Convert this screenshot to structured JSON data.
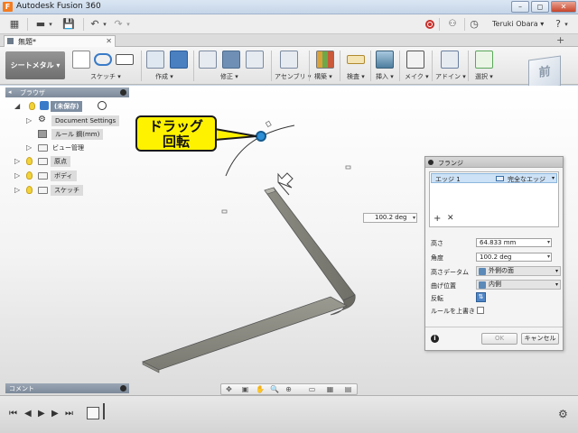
{
  "window": {
    "app_logo": "F",
    "title": "Autodesk Fusion 360",
    "minimize": "–",
    "restore": "◻",
    "close": "✕"
  },
  "quick_access": {
    "grid_icon": "▦",
    "file_icon": "▬",
    "save_icon": "💾",
    "undo_icon": "↶",
    "redo_icon": "↷",
    "dropdown": "▾",
    "help_icon": "?",
    "user_name": "Teruki Obara ▾"
  },
  "doc_tab": {
    "title": "無題*",
    "close": "✕",
    "new_tab": "+"
  },
  "ribbon": {
    "workspace": "シートメタル ▾",
    "groups": [
      {
        "label": "スケッチ ▾"
      },
      {
        "label": "作成 ▾"
      },
      {
        "label": "修正 ▾"
      },
      {
        "label": "アセンブリ ▾"
      },
      {
        "label": "構築 ▾"
      },
      {
        "label": "検査 ▾"
      },
      {
        "label": "挿入 ▾"
      },
      {
        "label": "メイク ▾"
      },
      {
        "label": "アドイン ▾"
      },
      {
        "label": "選択 ▾"
      }
    ],
    "colors": {
      "sketch": "#3a7bc8",
      "flange": "#4a7fc0",
      "modify": "#6f8fb5",
      "assembly": "#8a9bb0",
      "construct": "#6da84a",
      "inspect": "#d9a23a",
      "insert": "#4f7e9e",
      "make": "#7a7a7a",
      "addin": "#6a7fa0",
      "select": "#5aa85a"
    }
  },
  "view_cube": {
    "label": "前"
  },
  "browser": {
    "title": "ブラウザ",
    "root_label": "(未保存)",
    "items": [
      {
        "label": "Document Settings"
      },
      {
        "label": "ルール 鋼(mm)"
      },
      {
        "label": "ビュー管理"
      },
      {
        "label": "原点"
      },
      {
        "label": "ボディ"
      },
      {
        "label": "スケッチ"
      }
    ]
  },
  "comment_bar": {
    "label": "コメント"
  },
  "callout": {
    "line1": "ドラッグ",
    "line2": "回転"
  },
  "angle_input": {
    "value": "100.2 deg",
    "dropdown": "▾"
  },
  "flange_dialog": {
    "title": "フランジ",
    "edge_row": {
      "name": "エッジ 1",
      "option": "完全なエッジ",
      "dropdown": "▾"
    },
    "add_icon": "+",
    "remove_icon": "✕",
    "fields": {
      "height_label": "高さ",
      "height_value": "64.833 mm",
      "angle_label": "角度",
      "angle_value": "100.2 deg",
      "datum_label": "高さデータム",
      "datum_value": "外側の面",
      "bend_label": "曲げ位置",
      "bend_value": "内側",
      "flip_label": "反転",
      "override_label": "ルールを上書き"
    },
    "ok": "OK",
    "cancel": "キャンセル",
    "info_icon": "i"
  },
  "nav_toolbar": {
    "icons": [
      "✥",
      "▣",
      "✋",
      "🔍",
      "⊕",
      "▭",
      "▦",
      "▤"
    ]
  },
  "timeline": {
    "first": "⏮",
    "prev": "◀",
    "play": "▶",
    "next": "▶",
    "last": "⏭",
    "gear_icon": "⚙"
  }
}
